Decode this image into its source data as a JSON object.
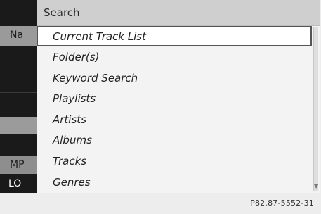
{
  "left_partial_labels": {
    "nav": "Na",
    "mp": "MP",
    "lo": "LO"
  },
  "panel": {
    "title": "Search",
    "items": [
      {
        "label": "Current Track List",
        "selected": true
      },
      {
        "label": "Folder(s)",
        "selected": false
      },
      {
        "label": "Keyword Search",
        "selected": false
      },
      {
        "label": "Playlists",
        "selected": false
      },
      {
        "label": "Artists",
        "selected": false
      },
      {
        "label": "Albums",
        "selected": false
      },
      {
        "label": "Tracks",
        "selected": false
      },
      {
        "label": "Genres",
        "selected": false
      }
    ]
  },
  "caption_code": "P82.87-5552-31",
  "colors": {
    "background": "#ededed",
    "header": "#cfcfcf",
    "panel": "#f3f3f3",
    "selected_border": "#555555"
  }
}
